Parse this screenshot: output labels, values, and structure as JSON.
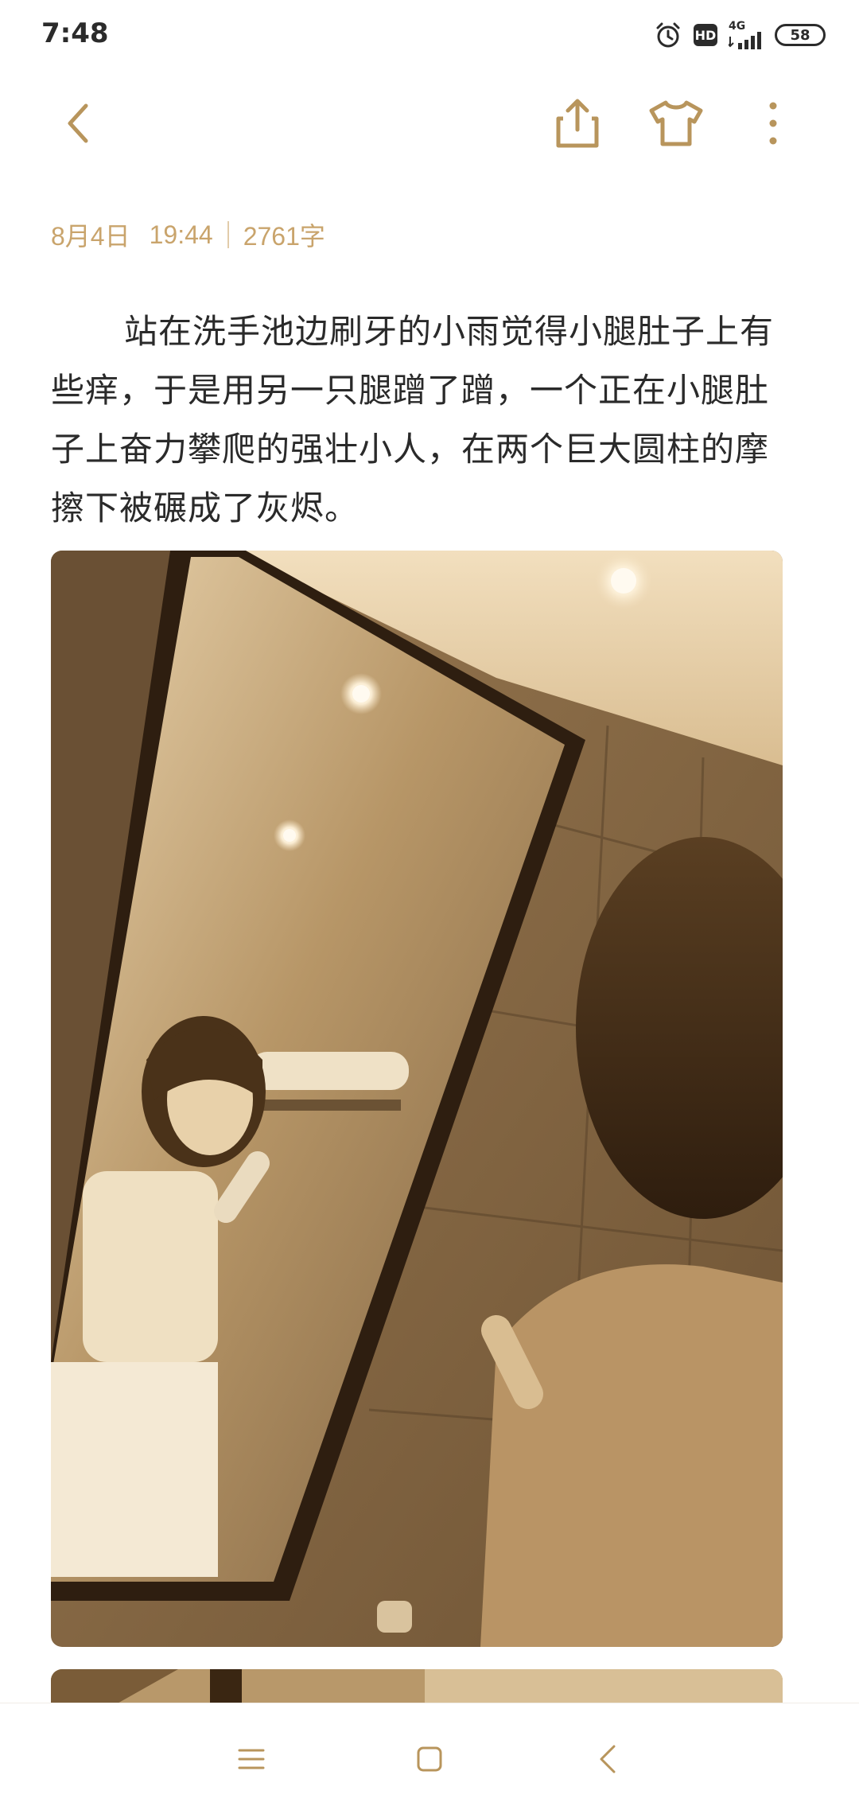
{
  "status_bar": {
    "time": "7:48",
    "hd_label": "HD",
    "network_label": "4G",
    "battery": "58"
  },
  "toolbar": {
    "back_icon": "chevron-left-icon",
    "share_icon": "share-icon",
    "theme_icon": "tshirt-icon",
    "more_icon": "more-vertical-icon"
  },
  "note": {
    "date": "8月4日",
    "time": "19:44",
    "word_count": "2761字",
    "text": "站在洗手池边刷牙的小雨觉得小腿肚子上有些痒，于是用另一只腿蹭了蹭，一个正在小腿肚子上奋力攀爬的强壮小人，在两个巨大圆柱的摩擦下被碾成了灰烬。"
  },
  "colors": {
    "accent": "#c9a46c",
    "text": "#2a2a2a",
    "icon": "#b8955c"
  },
  "nav_bar": {
    "menu_icon": "menu-icon",
    "home_icon": "square-home-icon",
    "back_icon": "back-triangle-icon"
  }
}
